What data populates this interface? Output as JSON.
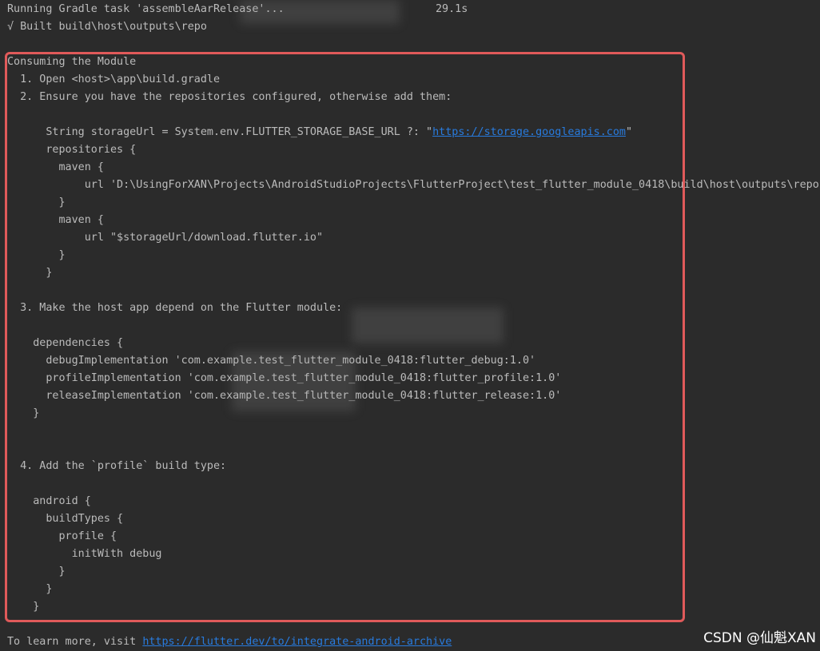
{
  "header": {
    "task_line": "Running Gradle task 'assembleAarRelease'...",
    "task_time": "29.1s",
    "built_line": "√ Built build\\host\\outputs\\repo"
  },
  "content": {
    "lines": [
      "Consuming the Module",
      "  1. Open <host>\\app\\build.gradle",
      "  2. Ensure you have the repositories configured, otherwise add them:",
      "",
      "      String storageUrl = System.env.FLUTTER_STORAGE_BASE_URL ?: \"",
      "      repositories {",
      "        maven {",
      "            url 'D:\\UsingForXAN\\Projects\\AndroidStudioProjects\\FlutterProject\\test_flutter_module_0418\\build\\host\\outputs\\repo'",
      "        }",
      "        maven {",
      "            url \"$storageUrl/download.flutter.io\"",
      "        }",
      "      }",
      "",
      "  3. Make the host app depend on the Flutter module:",
      "",
      "    dependencies {",
      "      debugImplementation 'com.example.test_flutter_module_0418:flutter_debug:1.0'",
      "      profileImplementation 'com.example.test_flutter_module_0418:flutter_profile:1.0'",
      "      releaseImplementation 'com.example.test_flutter_module_0418:flutter_release:1.0'",
      "    }",
      "",
      "",
      "  4. Add the `profile` build type:",
      "",
      "    android {",
      "      buildTypes {",
      "        profile {",
      "          initWith debug",
      "        }",
      "      }",
      "    }"
    ],
    "storage_link": "https://storage.googleapis.com",
    "storage_suffix": "\""
  },
  "footer": {
    "prefix": "To learn more, visit ",
    "link": "https://flutter.dev/to/integrate-android-archive"
  },
  "watermark": "CSDN @仙魁XAN"
}
